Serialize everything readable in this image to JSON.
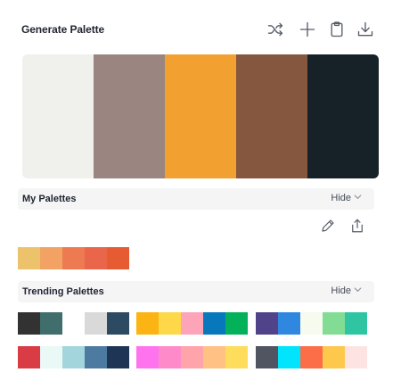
{
  "header": {
    "title": "Generate Palette",
    "tools": [
      {
        "name": "shuffle-icon"
      },
      {
        "name": "plus-icon"
      },
      {
        "name": "clipboard-icon"
      },
      {
        "name": "download-icon"
      }
    ]
  },
  "generated_palette": {
    "colors": [
      "#f0f0ec",
      "#9a8580",
      "#f2a02f",
      "#84573e",
      "#162128"
    ]
  },
  "my_palettes": {
    "label": "My Palettes",
    "hide_label": "Hide",
    "actions": [
      {
        "name": "edit-pencil-icon"
      },
      {
        "name": "share-icon"
      }
    ],
    "palettes": [
      [
        "#ecc36b",
        "#f2a363",
        "#ee7a52",
        "#e9664a",
        "#e75b33"
      ]
    ]
  },
  "trending_palettes": {
    "label": "Trending Palettes",
    "hide_label": "Hide",
    "palettes": [
      [
        "#323232",
        "#3f6e6c",
        "#ffffff",
        "#d9d9d9",
        "#2c4a61"
      ],
      [
        "#fbb414",
        "#fed849",
        "#fda4b8",
        "#0878bc",
        "#03b15a"
      ],
      [
        "#514389",
        "#2f87e0",
        "#f6faef",
        "#83dc94",
        "#2fc5a2"
      ],
      [
        "#d93c44",
        "#eaf8f6",
        "#a2d6dc",
        "#4d7aa1",
        "#1f3555"
      ],
      [
        "#ff74ee",
        "#ff8ac9",
        "#ffa4ab",
        "#ffc184",
        "#fedc5c"
      ],
      [
        "#515461",
        "#00e4fd",
        "#fc6e48",
        "#fec84d",
        "#fee3e3"
      ]
    ]
  },
  "colors": {
    "bar_bg": "#f5f5f6",
    "text": "#1f2430",
    "icon": "#555b66"
  }
}
